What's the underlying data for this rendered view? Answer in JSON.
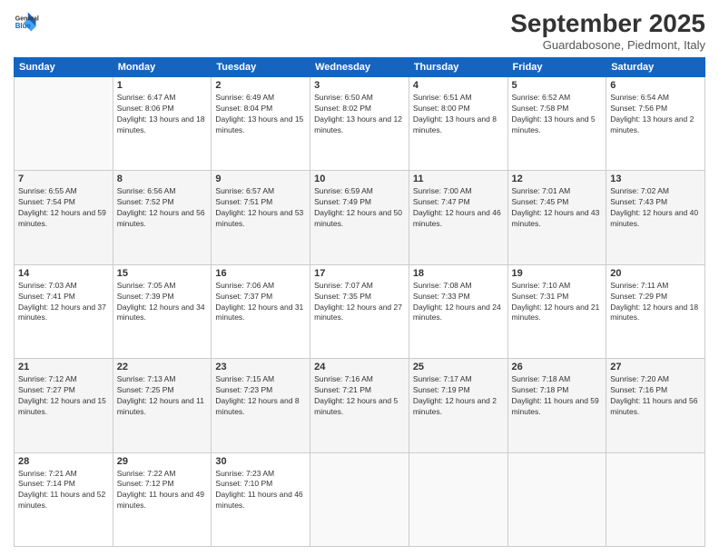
{
  "header": {
    "logo_line1": "General",
    "logo_line2": "Blue",
    "month_title": "September 2025",
    "location": "Guardabosone, Piedmont, Italy"
  },
  "weekdays": [
    "Sunday",
    "Monday",
    "Tuesday",
    "Wednesday",
    "Thursday",
    "Friday",
    "Saturday"
  ],
  "weeks": [
    [
      {
        "day": "",
        "sunrise": "",
        "sunset": "",
        "daylight": ""
      },
      {
        "day": "1",
        "sunrise": "Sunrise: 6:47 AM",
        "sunset": "Sunset: 8:06 PM",
        "daylight": "Daylight: 13 hours and 18 minutes."
      },
      {
        "day": "2",
        "sunrise": "Sunrise: 6:49 AM",
        "sunset": "Sunset: 8:04 PM",
        "daylight": "Daylight: 13 hours and 15 minutes."
      },
      {
        "day": "3",
        "sunrise": "Sunrise: 6:50 AM",
        "sunset": "Sunset: 8:02 PM",
        "daylight": "Daylight: 13 hours and 12 minutes."
      },
      {
        "day": "4",
        "sunrise": "Sunrise: 6:51 AM",
        "sunset": "Sunset: 8:00 PM",
        "daylight": "Daylight: 13 hours and 8 minutes."
      },
      {
        "day": "5",
        "sunrise": "Sunrise: 6:52 AM",
        "sunset": "Sunset: 7:58 PM",
        "daylight": "Daylight: 13 hours and 5 minutes."
      },
      {
        "day": "6",
        "sunrise": "Sunrise: 6:54 AM",
        "sunset": "Sunset: 7:56 PM",
        "daylight": "Daylight: 13 hours and 2 minutes."
      }
    ],
    [
      {
        "day": "7",
        "sunrise": "Sunrise: 6:55 AM",
        "sunset": "Sunset: 7:54 PM",
        "daylight": "Daylight: 12 hours and 59 minutes."
      },
      {
        "day": "8",
        "sunrise": "Sunrise: 6:56 AM",
        "sunset": "Sunset: 7:52 PM",
        "daylight": "Daylight: 12 hours and 56 minutes."
      },
      {
        "day": "9",
        "sunrise": "Sunrise: 6:57 AM",
        "sunset": "Sunset: 7:51 PM",
        "daylight": "Daylight: 12 hours and 53 minutes."
      },
      {
        "day": "10",
        "sunrise": "Sunrise: 6:59 AM",
        "sunset": "Sunset: 7:49 PM",
        "daylight": "Daylight: 12 hours and 50 minutes."
      },
      {
        "day": "11",
        "sunrise": "Sunrise: 7:00 AM",
        "sunset": "Sunset: 7:47 PM",
        "daylight": "Daylight: 12 hours and 46 minutes."
      },
      {
        "day": "12",
        "sunrise": "Sunrise: 7:01 AM",
        "sunset": "Sunset: 7:45 PM",
        "daylight": "Daylight: 12 hours and 43 minutes."
      },
      {
        "day": "13",
        "sunrise": "Sunrise: 7:02 AM",
        "sunset": "Sunset: 7:43 PM",
        "daylight": "Daylight: 12 hours and 40 minutes."
      }
    ],
    [
      {
        "day": "14",
        "sunrise": "Sunrise: 7:03 AM",
        "sunset": "Sunset: 7:41 PM",
        "daylight": "Daylight: 12 hours and 37 minutes."
      },
      {
        "day": "15",
        "sunrise": "Sunrise: 7:05 AM",
        "sunset": "Sunset: 7:39 PM",
        "daylight": "Daylight: 12 hours and 34 minutes."
      },
      {
        "day": "16",
        "sunrise": "Sunrise: 7:06 AM",
        "sunset": "Sunset: 7:37 PM",
        "daylight": "Daylight: 12 hours and 31 minutes."
      },
      {
        "day": "17",
        "sunrise": "Sunrise: 7:07 AM",
        "sunset": "Sunset: 7:35 PM",
        "daylight": "Daylight: 12 hours and 27 minutes."
      },
      {
        "day": "18",
        "sunrise": "Sunrise: 7:08 AM",
        "sunset": "Sunset: 7:33 PM",
        "daylight": "Daylight: 12 hours and 24 minutes."
      },
      {
        "day": "19",
        "sunrise": "Sunrise: 7:10 AM",
        "sunset": "Sunset: 7:31 PM",
        "daylight": "Daylight: 12 hours and 21 minutes."
      },
      {
        "day": "20",
        "sunrise": "Sunrise: 7:11 AM",
        "sunset": "Sunset: 7:29 PM",
        "daylight": "Daylight: 12 hours and 18 minutes."
      }
    ],
    [
      {
        "day": "21",
        "sunrise": "Sunrise: 7:12 AM",
        "sunset": "Sunset: 7:27 PM",
        "daylight": "Daylight: 12 hours and 15 minutes."
      },
      {
        "day": "22",
        "sunrise": "Sunrise: 7:13 AM",
        "sunset": "Sunset: 7:25 PM",
        "daylight": "Daylight: 12 hours and 11 minutes."
      },
      {
        "day": "23",
        "sunrise": "Sunrise: 7:15 AM",
        "sunset": "Sunset: 7:23 PM",
        "daylight": "Daylight: 12 hours and 8 minutes."
      },
      {
        "day": "24",
        "sunrise": "Sunrise: 7:16 AM",
        "sunset": "Sunset: 7:21 PM",
        "daylight": "Daylight: 12 hours and 5 minutes."
      },
      {
        "day": "25",
        "sunrise": "Sunrise: 7:17 AM",
        "sunset": "Sunset: 7:19 PM",
        "daylight": "Daylight: 12 hours and 2 minutes."
      },
      {
        "day": "26",
        "sunrise": "Sunrise: 7:18 AM",
        "sunset": "Sunset: 7:18 PM",
        "daylight": "Daylight: 11 hours and 59 minutes."
      },
      {
        "day": "27",
        "sunrise": "Sunrise: 7:20 AM",
        "sunset": "Sunset: 7:16 PM",
        "daylight": "Daylight: 11 hours and 56 minutes."
      }
    ],
    [
      {
        "day": "28",
        "sunrise": "Sunrise: 7:21 AM",
        "sunset": "Sunset: 7:14 PM",
        "daylight": "Daylight: 11 hours and 52 minutes."
      },
      {
        "day": "29",
        "sunrise": "Sunrise: 7:22 AM",
        "sunset": "Sunset: 7:12 PM",
        "daylight": "Daylight: 11 hours and 49 minutes."
      },
      {
        "day": "30",
        "sunrise": "Sunrise: 7:23 AM",
        "sunset": "Sunset: 7:10 PM",
        "daylight": "Daylight: 11 hours and 46 minutes."
      },
      {
        "day": "",
        "sunrise": "",
        "sunset": "",
        "daylight": ""
      },
      {
        "day": "",
        "sunrise": "",
        "sunset": "",
        "daylight": ""
      },
      {
        "day": "",
        "sunrise": "",
        "sunset": "",
        "daylight": ""
      },
      {
        "day": "",
        "sunrise": "",
        "sunset": "",
        "daylight": ""
      }
    ]
  ]
}
